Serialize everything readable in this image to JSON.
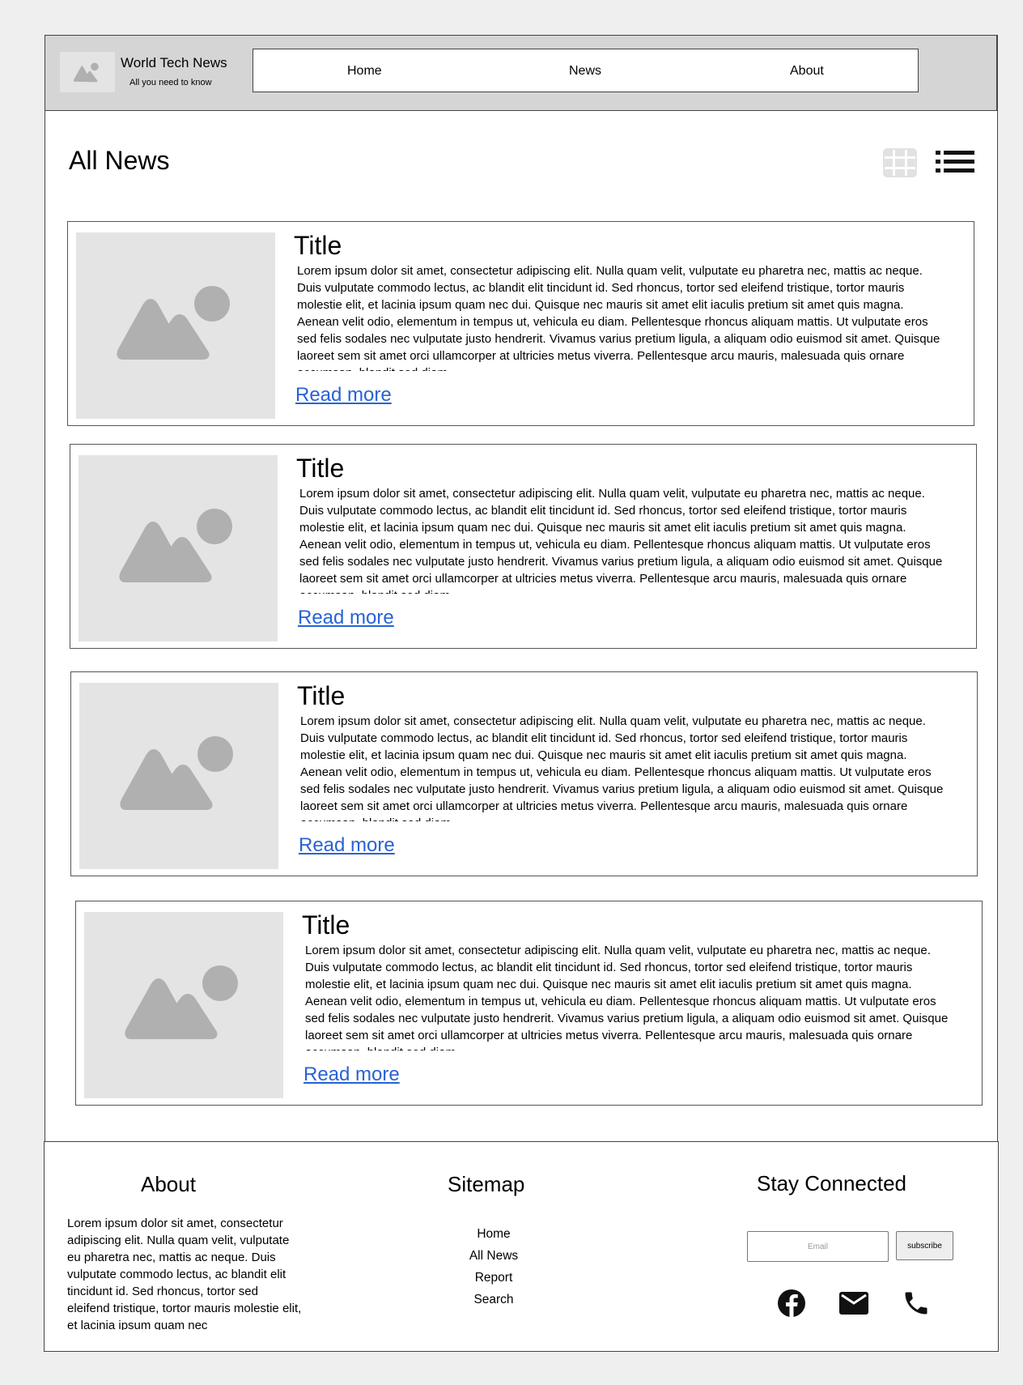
{
  "header": {
    "site_title": "World Tech News",
    "tagline": "All you need to know",
    "nav": [
      "Home",
      "News",
      "About"
    ]
  },
  "main": {
    "title": "All News",
    "view_icons": [
      "grid-view-icon",
      "list-view-icon"
    ],
    "articles": [
      {
        "title": "Title",
        "body": "Lorem ipsum dolor sit amet, consectetur adipiscing elit. Nulla quam velit, vulputate eu pharetra nec, mattis ac neque. Duis vulputate commodo lectus, ac blandit elit tincidunt id. Sed rhoncus, tortor sed eleifend tristique, tortor mauris molestie elit, et lacinia ipsum quam nec dui. Quisque nec mauris sit amet elit iaculis pretium sit amet quis magna. Aenean velit odio, elementum in tempus ut, vehicula eu diam. Pellentesque rhoncus aliquam mattis. Ut vulputate eros sed felis sodales nec vulputate justo hendrerit. Vivamus varius pretium ligula, a aliquam odio euismod sit amet. Quisque laoreet sem sit amet orci ullamcorper at ultricies metus viverra. Pellentesque arcu mauris, malesuada quis ornare accumsan, blandit sed diam.",
        "link": "Read more"
      },
      {
        "title": "Title",
        "body": "Lorem ipsum dolor sit amet, consectetur adipiscing elit. Nulla quam velit, vulputate eu pharetra nec, mattis ac neque. Duis vulputate commodo lectus, ac blandit elit tincidunt id. Sed rhoncus, tortor sed eleifend tristique, tortor mauris molestie elit, et lacinia ipsum quam nec dui. Quisque nec mauris sit amet elit iaculis pretium sit amet quis magna. Aenean velit odio, elementum in tempus ut, vehicula eu diam. Pellentesque rhoncus aliquam mattis. Ut vulputate eros sed felis sodales nec vulputate justo hendrerit. Vivamus varius pretium ligula, a aliquam odio euismod sit amet. Quisque laoreet sem sit amet orci ullamcorper at ultricies metus viverra. Pellentesque arcu mauris, malesuada quis ornare accumsan, blandit sed diam.",
        "link": "Read more"
      },
      {
        "title": "Title",
        "body": "Lorem ipsum dolor sit amet, consectetur adipiscing elit. Nulla quam velit, vulputate eu pharetra nec, mattis ac neque. Duis vulputate commodo lectus, ac blandit elit tincidunt id. Sed rhoncus, tortor sed eleifend tristique, tortor mauris molestie elit, et lacinia ipsum quam nec dui. Quisque nec mauris sit amet elit iaculis pretium sit amet quis magna. Aenean velit odio, elementum in tempus ut, vehicula eu diam. Pellentesque rhoncus aliquam mattis. Ut vulputate eros sed felis sodales nec vulputate justo hendrerit. Vivamus varius pretium ligula, a aliquam odio euismod sit amet. Quisque laoreet sem sit amet orci ullamcorper at ultricies metus viverra. Pellentesque arcu mauris, malesuada quis ornare accumsan, blandit sed diam.",
        "link": "Read more"
      },
      {
        "title": "Title",
        "body": "Lorem ipsum dolor sit amet, consectetur adipiscing elit. Nulla quam velit, vulputate eu pharetra nec, mattis ac neque. Duis vulputate commodo lectus, ac blandit elit tincidunt id. Sed rhoncus, tortor sed eleifend tristique, tortor mauris molestie elit, et lacinia ipsum quam nec dui. Quisque nec mauris sit amet elit iaculis pretium sit amet quis magna. Aenean velit odio, elementum in tempus ut, vehicula eu diam. Pellentesque rhoncus aliquam mattis. Ut vulputate eros sed felis sodales nec vulputate justo hendrerit. Vivamus varius pretium ligula, a aliquam odio euismod sit amet. Quisque laoreet sem sit amet orci ullamcorper at ultricies metus viverra. Pellentesque arcu mauris, malesuada quis ornare accumsan, blandit sed diam.",
        "link": "Read more"
      }
    ]
  },
  "footer": {
    "about_heading": "About",
    "about_text": "Lorem ipsum dolor sit amet, consectetur adipiscing elit. Nulla quam velit, vulputate eu pharetra nec, mattis ac neque. Duis vulputate commodo lectus, ac blandit elit tincidunt id. Sed rhoncus, tortor sed eleifend tristique, tortor mauris molestie elit, et lacinia ipsum quam nec",
    "sitemap_heading": "Sitemap",
    "sitemap_links": [
      "Home",
      "All News",
      "Report",
      "Search"
    ],
    "connect_heading": "Stay Connected",
    "email_placeholder": "Email",
    "subscribe_label": "subscribe",
    "social_icons": [
      "facebook-icon",
      "mail-icon",
      "phone-icon"
    ]
  },
  "colors": {
    "link": "#2962d6",
    "header_bg": "#d5d5d5",
    "placeholder_bg": "#e4e4e4",
    "placeholder_icon": "#b0b0b0"
  }
}
